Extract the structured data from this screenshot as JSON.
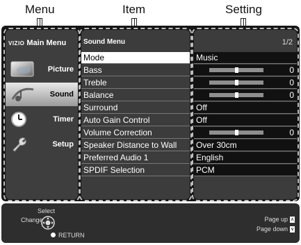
{
  "callouts": {
    "menu": "Menu",
    "item": "Item",
    "setting": "Setting"
  },
  "main_menu": {
    "brand": "VIZIO",
    "title": "Main Menu",
    "items": [
      {
        "label": "Picture",
        "icon": "picture-icon",
        "selected": false
      },
      {
        "label": "Sound",
        "icon": "sound-icon",
        "selected": true
      },
      {
        "label": "Timer",
        "icon": "clock-icon",
        "selected": false
      },
      {
        "label": "Setup",
        "icon": "wrench-icon",
        "selected": false
      }
    ]
  },
  "sound_menu": {
    "title": "Sound Menu",
    "page": "1/2",
    "rows": [
      {
        "item": "Mode",
        "setting": "Music",
        "type": "text",
        "selected": true
      },
      {
        "item": "Bass",
        "setting": "0",
        "type": "slider",
        "level": 0.5
      },
      {
        "item": "Treble",
        "setting": "0",
        "type": "slider",
        "level": 0.5
      },
      {
        "item": "Balance",
        "setting": "0",
        "type": "slider",
        "level": 0.5
      },
      {
        "item": "Surround",
        "setting": "Off",
        "type": "text"
      },
      {
        "item": "Auto Gain Control",
        "setting": "Off",
        "type": "text"
      },
      {
        "item": "Volume Correction",
        "setting": "0",
        "type": "slider",
        "level": 0.5
      },
      {
        "item": "Speaker Distance to Wall",
        "setting": "Over 30cm",
        "type": "text"
      },
      {
        "item": "Preferred Audio 1",
        "setting": "English",
        "type": "text"
      },
      {
        "item": "SPDIF Selection",
        "setting": "PCM",
        "type": "text"
      }
    ]
  },
  "help_bar": {
    "select": "Select",
    "change": "Change",
    "return": "RETURN",
    "page_up": "Page up",
    "page_down": "Page down"
  },
  "colors": {
    "screen_bg": "#161616",
    "panel_bg": "#3c3c3c",
    "selected_row": "#ffffff"
  }
}
